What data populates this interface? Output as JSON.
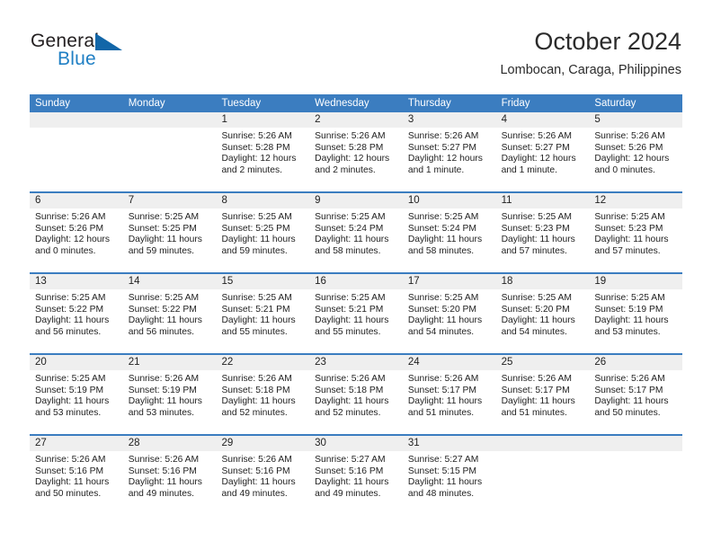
{
  "brand": {
    "word_general": "General",
    "word_blue": "Blue",
    "triangle_icon": "triangle-icon"
  },
  "header": {
    "title": "October 2024",
    "location": "Lombocan, Caraga, Philippines"
  },
  "calendar": {
    "accent_color": "#3b7dc0",
    "day_band_color": "#efefef",
    "weekdays": [
      "Sunday",
      "Monday",
      "Tuesday",
      "Wednesday",
      "Thursday",
      "Friday",
      "Saturday"
    ],
    "weeks": [
      [
        {
          "day": "",
          "sunrise": "",
          "sunset": "",
          "daylight_line1": "",
          "daylight_line2": "",
          "empty": true
        },
        {
          "day": "",
          "sunrise": "",
          "sunset": "",
          "daylight_line1": "",
          "daylight_line2": "",
          "empty": true
        },
        {
          "day": "1",
          "sunrise": "Sunrise: 5:26 AM",
          "sunset": "Sunset: 5:28 PM",
          "daylight_line1": "Daylight: 12 hours",
          "daylight_line2": "and 2 minutes."
        },
        {
          "day": "2",
          "sunrise": "Sunrise: 5:26 AM",
          "sunset": "Sunset: 5:28 PM",
          "daylight_line1": "Daylight: 12 hours",
          "daylight_line2": "and 2 minutes."
        },
        {
          "day": "3",
          "sunrise": "Sunrise: 5:26 AM",
          "sunset": "Sunset: 5:27 PM",
          "daylight_line1": "Daylight: 12 hours",
          "daylight_line2": "and 1 minute."
        },
        {
          "day": "4",
          "sunrise": "Sunrise: 5:26 AM",
          "sunset": "Sunset: 5:27 PM",
          "daylight_line1": "Daylight: 12 hours",
          "daylight_line2": "and 1 minute."
        },
        {
          "day": "5",
          "sunrise": "Sunrise: 5:26 AM",
          "sunset": "Sunset: 5:26 PM",
          "daylight_line1": "Daylight: 12 hours",
          "daylight_line2": "and 0 minutes."
        }
      ],
      [
        {
          "day": "6",
          "sunrise": "Sunrise: 5:26 AM",
          "sunset": "Sunset: 5:26 PM",
          "daylight_line1": "Daylight: 12 hours",
          "daylight_line2": "and 0 minutes."
        },
        {
          "day": "7",
          "sunrise": "Sunrise: 5:25 AM",
          "sunset": "Sunset: 5:25 PM",
          "daylight_line1": "Daylight: 11 hours",
          "daylight_line2": "and 59 minutes."
        },
        {
          "day": "8",
          "sunrise": "Sunrise: 5:25 AM",
          "sunset": "Sunset: 5:25 PM",
          "daylight_line1": "Daylight: 11 hours",
          "daylight_line2": "and 59 minutes."
        },
        {
          "day": "9",
          "sunrise": "Sunrise: 5:25 AM",
          "sunset": "Sunset: 5:24 PM",
          "daylight_line1": "Daylight: 11 hours",
          "daylight_line2": "and 58 minutes."
        },
        {
          "day": "10",
          "sunrise": "Sunrise: 5:25 AM",
          "sunset": "Sunset: 5:24 PM",
          "daylight_line1": "Daylight: 11 hours",
          "daylight_line2": "and 58 minutes."
        },
        {
          "day": "11",
          "sunrise": "Sunrise: 5:25 AM",
          "sunset": "Sunset: 5:23 PM",
          "daylight_line1": "Daylight: 11 hours",
          "daylight_line2": "and 57 minutes."
        },
        {
          "day": "12",
          "sunrise": "Sunrise: 5:25 AM",
          "sunset": "Sunset: 5:23 PM",
          "daylight_line1": "Daylight: 11 hours",
          "daylight_line2": "and 57 minutes."
        }
      ],
      [
        {
          "day": "13",
          "sunrise": "Sunrise: 5:25 AM",
          "sunset": "Sunset: 5:22 PM",
          "daylight_line1": "Daylight: 11 hours",
          "daylight_line2": "and 56 minutes."
        },
        {
          "day": "14",
          "sunrise": "Sunrise: 5:25 AM",
          "sunset": "Sunset: 5:22 PM",
          "daylight_line1": "Daylight: 11 hours",
          "daylight_line2": "and 56 minutes."
        },
        {
          "day": "15",
          "sunrise": "Sunrise: 5:25 AM",
          "sunset": "Sunset: 5:21 PM",
          "daylight_line1": "Daylight: 11 hours",
          "daylight_line2": "and 55 minutes."
        },
        {
          "day": "16",
          "sunrise": "Sunrise: 5:25 AM",
          "sunset": "Sunset: 5:21 PM",
          "daylight_line1": "Daylight: 11 hours",
          "daylight_line2": "and 55 minutes."
        },
        {
          "day": "17",
          "sunrise": "Sunrise: 5:25 AM",
          "sunset": "Sunset: 5:20 PM",
          "daylight_line1": "Daylight: 11 hours",
          "daylight_line2": "and 54 minutes."
        },
        {
          "day": "18",
          "sunrise": "Sunrise: 5:25 AM",
          "sunset": "Sunset: 5:20 PM",
          "daylight_line1": "Daylight: 11 hours",
          "daylight_line2": "and 54 minutes."
        },
        {
          "day": "19",
          "sunrise": "Sunrise: 5:25 AM",
          "sunset": "Sunset: 5:19 PM",
          "daylight_line1": "Daylight: 11 hours",
          "daylight_line2": "and 53 minutes."
        }
      ],
      [
        {
          "day": "20",
          "sunrise": "Sunrise: 5:25 AM",
          "sunset": "Sunset: 5:19 PM",
          "daylight_line1": "Daylight: 11 hours",
          "daylight_line2": "and 53 minutes."
        },
        {
          "day": "21",
          "sunrise": "Sunrise: 5:26 AM",
          "sunset": "Sunset: 5:19 PM",
          "daylight_line1": "Daylight: 11 hours",
          "daylight_line2": "and 53 minutes."
        },
        {
          "day": "22",
          "sunrise": "Sunrise: 5:26 AM",
          "sunset": "Sunset: 5:18 PM",
          "daylight_line1": "Daylight: 11 hours",
          "daylight_line2": "and 52 minutes."
        },
        {
          "day": "23",
          "sunrise": "Sunrise: 5:26 AM",
          "sunset": "Sunset: 5:18 PM",
          "daylight_line1": "Daylight: 11 hours",
          "daylight_line2": "and 52 minutes."
        },
        {
          "day": "24",
          "sunrise": "Sunrise: 5:26 AM",
          "sunset": "Sunset: 5:17 PM",
          "daylight_line1": "Daylight: 11 hours",
          "daylight_line2": "and 51 minutes."
        },
        {
          "day": "25",
          "sunrise": "Sunrise: 5:26 AM",
          "sunset": "Sunset: 5:17 PM",
          "daylight_line1": "Daylight: 11 hours",
          "daylight_line2": "and 51 minutes."
        },
        {
          "day": "26",
          "sunrise": "Sunrise: 5:26 AM",
          "sunset": "Sunset: 5:17 PM",
          "daylight_line1": "Daylight: 11 hours",
          "daylight_line2": "and 50 minutes."
        }
      ],
      [
        {
          "day": "27",
          "sunrise": "Sunrise: 5:26 AM",
          "sunset": "Sunset: 5:16 PM",
          "daylight_line1": "Daylight: 11 hours",
          "daylight_line2": "and 50 minutes."
        },
        {
          "day": "28",
          "sunrise": "Sunrise: 5:26 AM",
          "sunset": "Sunset: 5:16 PM",
          "daylight_line1": "Daylight: 11 hours",
          "daylight_line2": "and 49 minutes."
        },
        {
          "day": "29",
          "sunrise": "Sunrise: 5:26 AM",
          "sunset": "Sunset: 5:16 PM",
          "daylight_line1": "Daylight: 11 hours",
          "daylight_line2": "and 49 minutes."
        },
        {
          "day": "30",
          "sunrise": "Sunrise: 5:27 AM",
          "sunset": "Sunset: 5:16 PM",
          "daylight_line1": "Daylight: 11 hours",
          "daylight_line2": "and 49 minutes."
        },
        {
          "day": "31",
          "sunrise": "Sunrise: 5:27 AM",
          "sunset": "Sunset: 5:15 PM",
          "daylight_line1": "Daylight: 11 hours",
          "daylight_line2": "and 48 minutes."
        },
        {
          "day": "",
          "sunrise": "",
          "sunset": "",
          "daylight_line1": "",
          "daylight_line2": "",
          "empty": true
        },
        {
          "day": "",
          "sunrise": "",
          "sunset": "",
          "daylight_line1": "",
          "daylight_line2": "",
          "empty": true
        }
      ]
    ]
  }
}
